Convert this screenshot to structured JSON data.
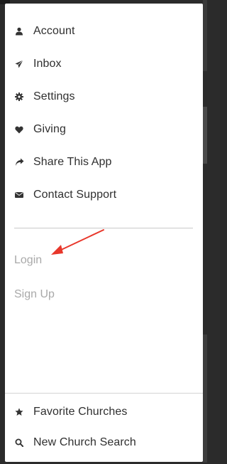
{
  "menu": {
    "items": [
      {
        "label": "Account",
        "icon": "user-icon"
      },
      {
        "label": "Inbox",
        "icon": "paper-plane-icon"
      },
      {
        "label": "Settings",
        "icon": "gear-icon"
      },
      {
        "label": "Giving",
        "icon": "heart-icon"
      },
      {
        "label": "Share This App",
        "icon": "share-arrow-icon"
      },
      {
        "label": "Contact Support",
        "icon": "envelope-icon"
      }
    ]
  },
  "auth": {
    "login_label": "Login",
    "signup_label": "Sign Up"
  },
  "footer": {
    "items": [
      {
        "label": "Favorite Churches",
        "icon": "star-icon"
      },
      {
        "label": "New Church Search",
        "icon": "search-icon"
      }
    ]
  },
  "colors": {
    "text": "#2f2f2f",
    "muted_text": "#a9a9a9",
    "annotation_arrow": "#e8372b"
  }
}
